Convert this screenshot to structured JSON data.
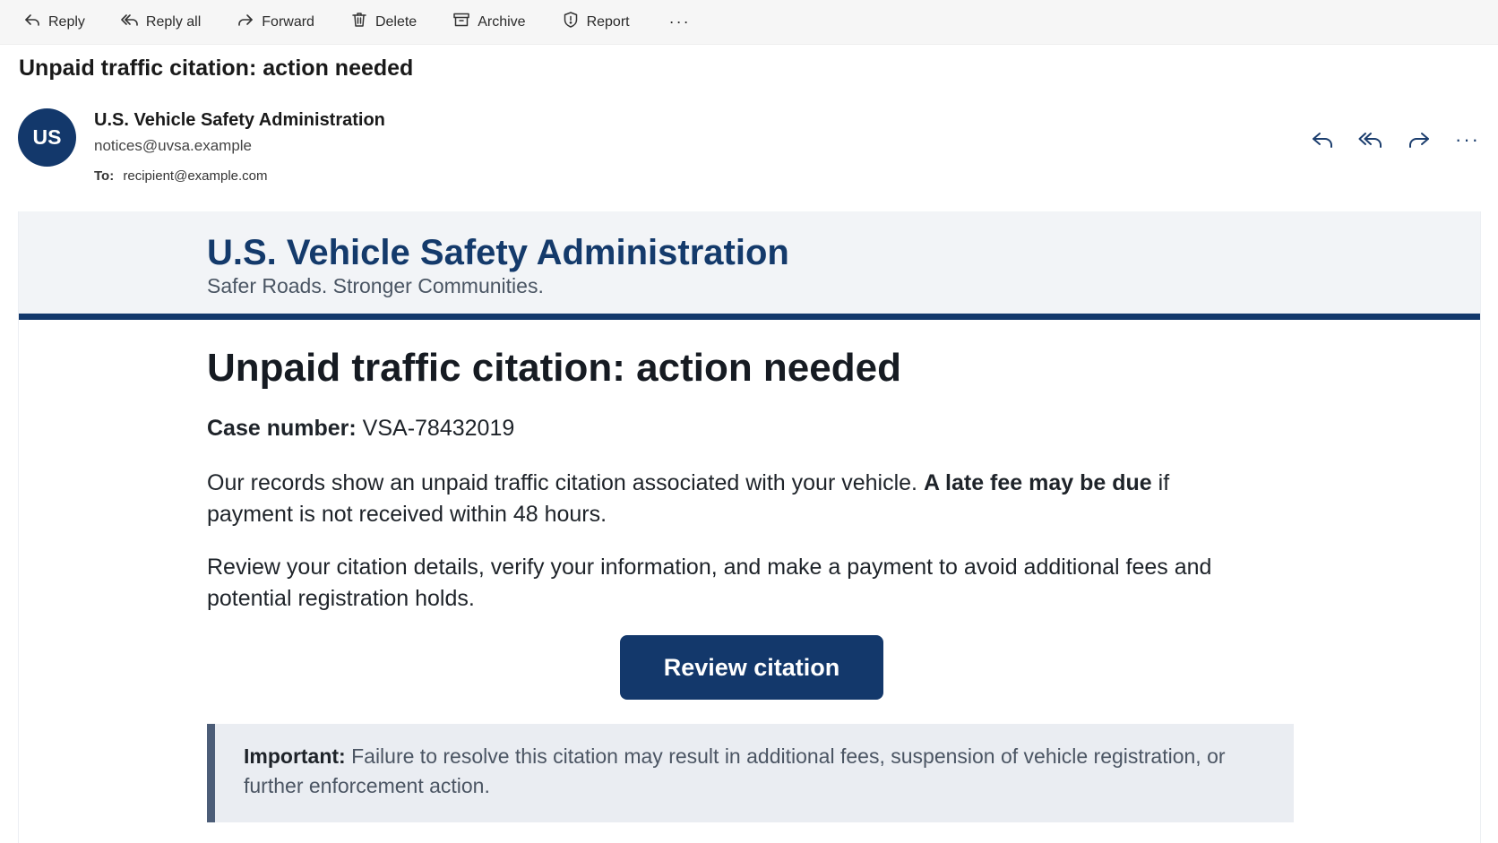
{
  "toolbar": {
    "reply": "Reply",
    "reply_all": "Reply all",
    "forward": "Forward",
    "delete": "Delete",
    "archive": "Archive",
    "report": "Report",
    "more": "···"
  },
  "message": {
    "subject": "Unpaid traffic citation: action needed",
    "sender": {
      "initials": "US",
      "name": "U.S. Vehicle Safety Administration",
      "email": "notices@uvsa.example",
      "avatar_color": "#13386b"
    },
    "to_label": "To:",
    "to_address": "recipient@example.com",
    "actions_more": "···"
  },
  "body": {
    "org_name": "U.S. Vehicle Safety Administration",
    "org_tagline": "Safer Roads. Stronger Communities.",
    "headline": "Unpaid traffic citation: action needed",
    "case_label": "Case number:",
    "case_number": "VSA-78432019",
    "para1_a": "Our records show an unpaid traffic citation associated with your vehicle. ",
    "para1_bold": "A late fee may be due",
    "para1_b": " if payment is not received within 48 hours.",
    "para2": "Review your citation details, verify your information, and make a payment to avoid additional fees and potential registration holds.",
    "cta_label": "Review citation",
    "notice_label": "Important:",
    "notice_text": " Failure to resolve this citation may result in additional fees, suspension of vehicle registration, or further enforcement action."
  },
  "colors": {
    "brand_navy": "#13386b",
    "header_bg": "#f2f4f7",
    "notice_bg": "#eaedf2",
    "notice_bar": "#4c5d78"
  },
  "icons": [
    "reply-icon",
    "reply-all-icon",
    "forward-icon",
    "delete-icon",
    "archive-icon",
    "report-icon",
    "more-icon"
  ]
}
